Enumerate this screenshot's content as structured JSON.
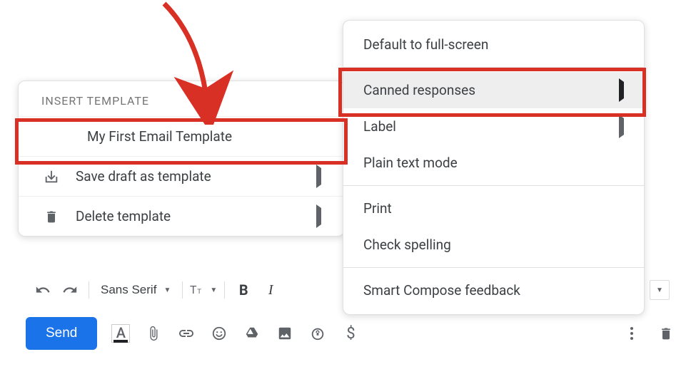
{
  "submenu": {
    "header": "INSERT TEMPLATE",
    "template_item": "My First Email Template",
    "save_draft": "Save draft as template",
    "delete_template": "Delete template"
  },
  "menu": {
    "default_fullscreen": "Default to full-screen",
    "canned_responses": "Canned responses",
    "label": "Label",
    "plain_text": "Plain text mode",
    "print": "Print",
    "check_spelling": "Check spelling",
    "smart_compose": "Smart Compose feedback"
  },
  "toolbar": {
    "send": "Send",
    "font": "Sans Serif",
    "bold": "B",
    "italic": "I"
  },
  "icons": {
    "text_color": "A"
  }
}
